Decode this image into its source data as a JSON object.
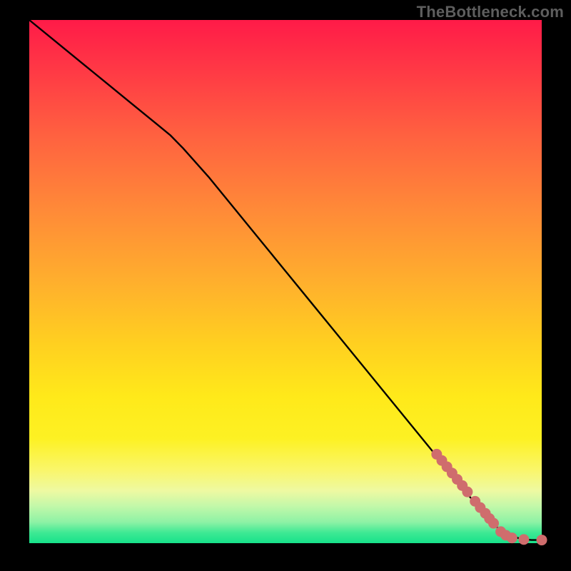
{
  "watermark": {
    "text": "TheBottleneck.com"
  },
  "colors": {
    "line": "#000000",
    "marker_fill": "#cf6d6d",
    "marker_stroke": "#c65e5e"
  },
  "chart_data": {
    "type": "line",
    "title": "",
    "xlabel": "",
    "ylabel": "",
    "xlim": [
      0,
      100
    ],
    "ylim": [
      0,
      100
    ],
    "series": [
      {
        "name": "curve",
        "style": "line",
        "x": [
          0,
          5,
          10,
          15,
          20,
          25,
          27.5,
          30,
          35,
          40,
          45,
          50,
          55,
          60,
          65,
          70,
          75,
          80,
          85,
          88,
          90,
          92,
          94,
          96,
          98,
          100
        ],
        "y": [
          100,
          96,
          92,
          88,
          84,
          80,
          78,
          75.5,
          70,
          64,
          58,
          52,
          46,
          40,
          34,
          28,
          22,
          16,
          10,
          6.5,
          4.2,
          2.4,
          1.4,
          0.8,
          0.6,
          0.6
        ]
      },
      {
        "name": "points-upper-cluster",
        "style": "scatter",
        "x": [
          79.5,
          80.5,
          81.5,
          82.5,
          83.5,
          84.5,
          85.5
        ],
        "y": [
          17.0,
          15.8,
          14.6,
          13.4,
          12.2,
          11.0,
          9.8
        ]
      },
      {
        "name": "points-lower-cluster",
        "style": "scatter",
        "x": [
          87.0,
          88.0,
          89.0,
          89.8,
          90.6
        ],
        "y": [
          8.0,
          6.8,
          5.7,
          4.7,
          3.8
        ]
      },
      {
        "name": "points-tail",
        "style": "scatter",
        "x": [
          92.0,
          93.0,
          94.2,
          96.5,
          100.0
        ],
        "y": [
          2.2,
          1.5,
          1.0,
          0.7,
          0.6
        ]
      }
    ]
  }
}
